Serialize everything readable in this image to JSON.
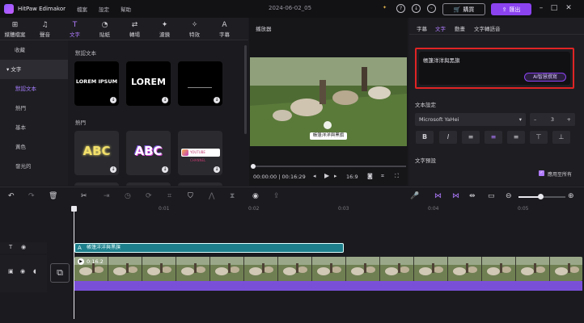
{
  "app": {
    "name": "HitPaw Edimakor",
    "menus": [
      "檔案",
      "設定",
      "幫助"
    ],
    "doc_title": "2024-06-02_05",
    "buy": "購買",
    "export": "匯出"
  },
  "toolbar": [
    {
      "label": "媒體檔案",
      "icon": "media-icon",
      "glyph": "⊞"
    },
    {
      "label": "聲音",
      "icon": "music-icon",
      "glyph": "♫"
    },
    {
      "label": "文字",
      "icon": "text-icon",
      "glyph": "T"
    },
    {
      "label": "貼紙",
      "icon": "sticker-icon",
      "glyph": "◔"
    },
    {
      "label": "轉場",
      "icon": "transition-icon",
      "glyph": "⇄"
    },
    {
      "label": "濾鏡",
      "icon": "filter-icon",
      "glyph": "✦"
    },
    {
      "label": "特效",
      "icon": "effects-icon",
      "glyph": "✧"
    },
    {
      "label": "字幕",
      "icon": "subtitle-icon",
      "glyph": "A"
    }
  ],
  "sidebar": {
    "items": [
      "收藏",
      "文字",
      "默認文本",
      "熱門",
      "基本",
      "黃色",
      "發光的"
    ]
  },
  "library": {
    "section_default": "默認文本",
    "section_hot": "熱門",
    "cards": [
      "LOREM IPSUM",
      "LOREM",
      "",
      "ABC",
      "ABC",
      "YOUTUBE CHANNEL"
    ]
  },
  "player": {
    "label": "播放器",
    "caption": "帳篷洋洋與黑旗",
    "time": "00:00:00 | 00:16:29",
    "ratio": "16:9"
  },
  "right": {
    "tabs": [
      "字幕",
      "文字",
      "動畫",
      "文字轉語音"
    ],
    "text_value": "帳篷洋洋與黑旗",
    "ai_button": "AI智慧撰寫",
    "text_settings": "文本設定",
    "font": "Microsoft YaHei",
    "size": "3",
    "presets": "文字預設",
    "apply_all": "應用至所有"
  },
  "timeline": {
    "ticks": [
      "0:01",
      "0:02",
      "0:03",
      "0:04",
      "0:05"
    ],
    "text_clip": "帳篷洋洋與黑旗",
    "video_clip_time": "0:16.2"
  },
  "colors": {
    "accent": "#8b43f0",
    "highlight_box": "#e02424",
    "text_track": "#1e7f8c",
    "audio_track": "#7a4fd8"
  }
}
